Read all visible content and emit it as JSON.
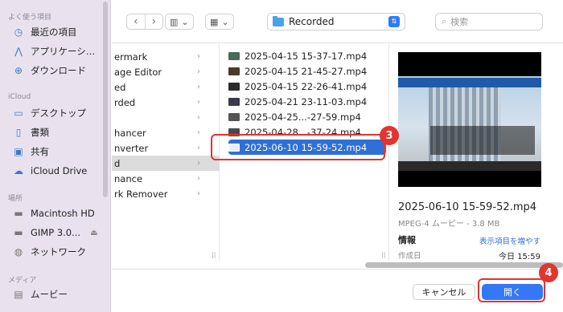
{
  "sidebar": {
    "favorites_header": "よく使う項目",
    "favorites": [
      {
        "label": "最近の項目",
        "icon": "clock-icon"
      },
      {
        "label": "アプリケーシ…",
        "icon": "apps-icon"
      },
      {
        "label": "ダウンロード",
        "icon": "download-icon"
      }
    ],
    "icloud_header": "iCloud",
    "icloud": [
      {
        "label": "デスクトップ",
        "icon": "desktop-icon"
      },
      {
        "label": "書類",
        "icon": "document-icon"
      },
      {
        "label": "共有",
        "icon": "shared-folder-icon"
      },
      {
        "label": "iCloud Drive",
        "icon": "cloud-icon"
      }
    ],
    "locations_header": "場所",
    "locations": [
      {
        "label": "Macintosh HD",
        "icon": "disk-icon"
      },
      {
        "label": "GIMP 3.0...",
        "icon": "disk-icon"
      },
      {
        "label": "ネットワーク",
        "icon": "network-icon"
      }
    ],
    "media_header": "メディア",
    "media": [
      {
        "label": "ムービー",
        "icon": "film-icon"
      }
    ]
  },
  "toolbar": {
    "path_label": "Recorded",
    "search_placeholder": "検索"
  },
  "column1": {
    "items": [
      "ermark",
      "age Editor",
      "ed",
      "rded",
      "",
      "hancer",
      "nverter",
      "d",
      "nance",
      "rk Remover"
    ]
  },
  "column2": {
    "files": [
      "2025-04-15 15-37-17.mp4",
      "2025-04-15 21-45-27.mp4",
      "2025-04-15 22-26-41.mp4",
      "2025-04-21 23-11-03.mp4",
      "2025-04-25...-27-59.mp4",
      "2025-04-28...-37-24.mp4",
      "2025-06-10 15-59-52.mp4"
    ]
  },
  "preview": {
    "title": "2025-06-10 15-59-52.mp4",
    "subtitle": "MPEG-4 ムービー - 3.8 MB",
    "info_label": "情報",
    "show_more": "表示項目を増やす",
    "created_label": "作成日",
    "created_value": "今日 15:59"
  },
  "buttons": {
    "cancel": "キャンセル",
    "open": "開く"
  },
  "annotations": {
    "badge_3": "3",
    "badge_4": "4"
  },
  "colors": {
    "accent": "#2f6fd6",
    "annotation": "#e3342f",
    "sidebar_bg": "#e9e2ee"
  }
}
